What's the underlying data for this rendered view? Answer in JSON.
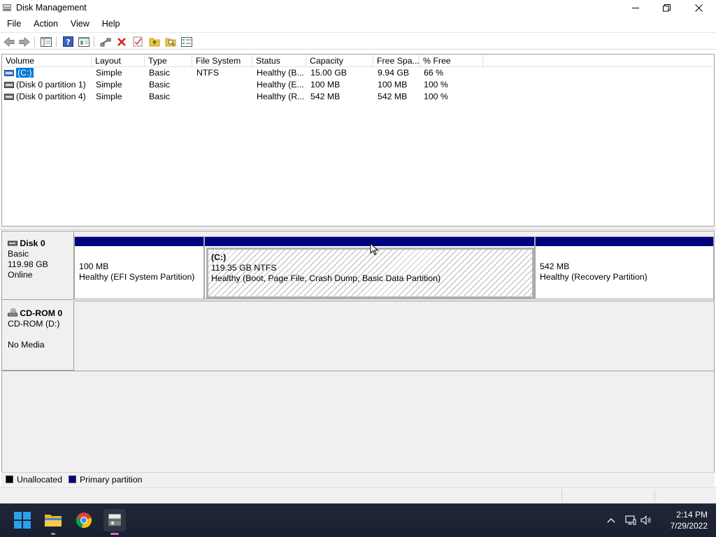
{
  "window": {
    "title": "Disk Management"
  },
  "menu": [
    "File",
    "Action",
    "View",
    "Help"
  ],
  "toolbar_icons": [
    "back-arrow-icon",
    "forward-arrow-icon",
    "console-tree-icon",
    "help-icon",
    "properties-icon",
    "connect-icon",
    "delete-icon",
    "check-icon",
    "up-folder-icon",
    "search-folder-icon",
    "list-icon"
  ],
  "volume_list": {
    "columns": [
      "Volume",
      "Layout",
      "Type",
      "File System",
      "Status",
      "Capacity",
      "Free Spa...",
      "% Free"
    ],
    "rows": [
      {
        "volume": "(C:)",
        "layout": "Simple",
        "type": "Basic",
        "fs": "NTFS",
        "status": "Healthy (B...",
        "capacity": "15.00 GB",
        "free": "9.94 GB",
        "pct": "66 %",
        "selected": true
      },
      {
        "volume": "(Disk 0 partition 1)",
        "layout": "Simple",
        "type": "Basic",
        "fs": "",
        "status": "Healthy (E...",
        "capacity": "100 MB",
        "free": "100 MB",
        "pct": "100 %",
        "selected": false
      },
      {
        "volume": "(Disk 0 partition 4)",
        "layout": "Simple",
        "type": "Basic",
        "fs": "",
        "status": "Healthy (R...",
        "capacity": "542 MB",
        "free": "542 MB",
        "pct": "100 %",
        "selected": false
      }
    ]
  },
  "disks": {
    "disk0": {
      "name": "Disk 0",
      "type": "Basic",
      "size": "119.98 GB",
      "state": "Online",
      "partitions": [
        {
          "name": "",
          "size": "100 MB",
          "status": "Healthy (EFI System Partition)"
        },
        {
          "name": "(C:)",
          "size": "119.35 GB NTFS",
          "status": "Healthy (Boot, Page File, Crash Dump, Basic Data Partition)"
        },
        {
          "name": "",
          "size": "542 MB",
          "status": "Healthy (Recovery Partition)"
        }
      ]
    },
    "cdrom0": {
      "name": "CD-ROM 0",
      "drive": "CD-ROM (D:)",
      "media": "No Media"
    }
  },
  "legend": {
    "unallocated": "Unallocated",
    "primary": "Primary partition",
    "unallocated_color": "#000000",
    "primary_color": "#000080"
  },
  "taskbar": {
    "apps": [
      "start-icon",
      "file-explorer-icon",
      "chrome-icon",
      "disk-management-icon"
    ],
    "time": "2:14 PM",
    "date": "7/29/2022"
  }
}
